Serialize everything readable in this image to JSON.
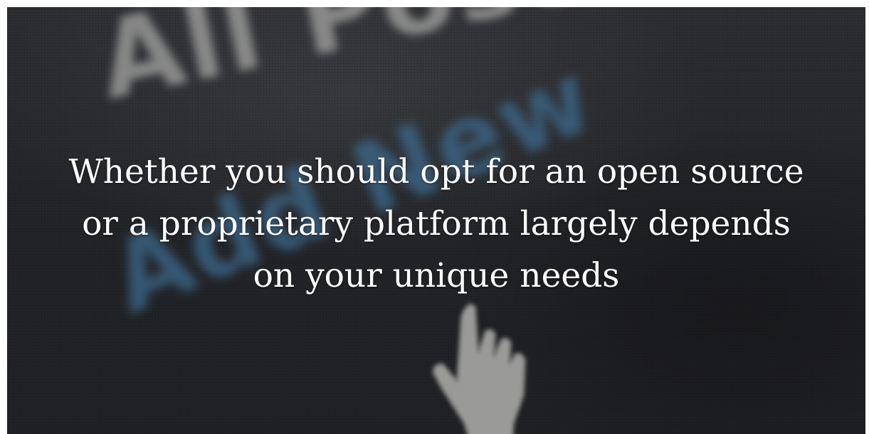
{
  "image": {
    "background_words": {
      "top": "All Posts",
      "bottom": "Add New"
    },
    "icon": "hand-pointer-cursor-icon",
    "colors": {
      "screen_dark": "#2a2c2f",
      "top_word": "#cfd0cc",
      "bottom_word": "#4f8fc0",
      "headline_text": "#ffffff"
    }
  },
  "headline": {
    "lines": [
      "Whether you should opt for an open source",
      "or a proprietary platform largely depends",
      "on your unique needs"
    ]
  }
}
